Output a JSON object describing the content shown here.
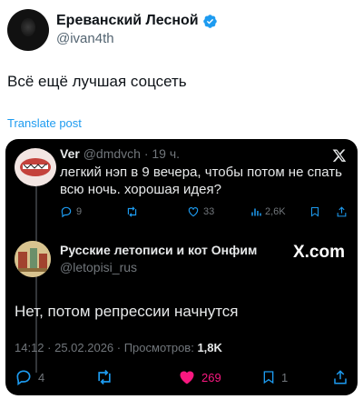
{
  "author": {
    "name": "Ереванский Лесной",
    "handle": "@ivan4th",
    "verified_color": "#1d9bf0"
  },
  "post": {
    "text": "Всё ещё лучшая соцсеть",
    "translate_label": "Translate post"
  },
  "embedded": {
    "quoted": {
      "name": "Ver",
      "handle": "@dmdvch",
      "time": "· 19 ч.",
      "text": "легкий нэп в 9 вечера, чтобы потом не спать всю ночь. хорошая идея?",
      "actions": {
        "replies": "9",
        "retweets": "",
        "likes": "33",
        "views": "2,6K"
      }
    },
    "reply": {
      "name": "Русские летописи и кот Онфим",
      "handle": "@letopisi_rus",
      "text": "Нет, потом репрессии начнутся",
      "meta_prefix": "14:12 · 25.02.2026 · Просмотров:",
      "views": "1,8K",
      "actions": {
        "replies": "4",
        "likes": "269",
        "bookmarks": "1"
      }
    },
    "x_com_label": "X.com"
  },
  "colors": {
    "card_bg": "#000000",
    "accent": "#1d9bf0",
    "like": "#f91880",
    "muted": "#71767b"
  }
}
